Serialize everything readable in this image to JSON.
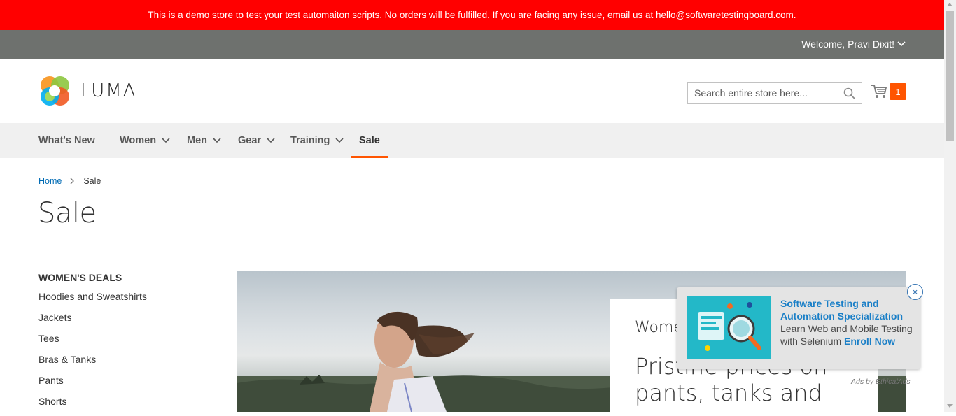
{
  "demo_notice": "This is a demo store to test your test automaiton scripts. No orders will be fulfilled. If you are facing any issue, email us at hello@softwaretestingboard.com.",
  "header_panel": {
    "welcome": "Welcome, Pravi Dixit!"
  },
  "logo": {
    "text": "LUMA"
  },
  "search": {
    "placeholder": "Search entire store here..."
  },
  "cart": {
    "count": "1"
  },
  "nav": [
    {
      "label": "What's New"
    },
    {
      "label": "Women"
    },
    {
      "label": "Men"
    },
    {
      "label": "Gear"
    },
    {
      "label": "Training"
    },
    {
      "label": "Sale"
    }
  ],
  "breadcrumb": {
    "home": "Home",
    "current": "Sale"
  },
  "page_title": "Sale",
  "sidebar": {
    "heading": "WOMEN'S DEALS",
    "items": [
      "Hoodies and Sweatshirts",
      "Jackets",
      "Tees",
      "Bras & Tanks",
      "Pants",
      "Shorts"
    ]
  },
  "hero": {
    "small": "Women",
    "big": "Pristine prices on pants, tanks and"
  },
  "ad": {
    "title": "Software Testing and Automation Specialization",
    "body": "Learn Web and Mobile Testing with Selenium",
    "cta": "Enroll Now",
    "attribution": "Ads by EthicalAds",
    "close": "×"
  },
  "colors": {
    "demo_bar": "#ff0000",
    "accent": "#ff5501",
    "link": "#006bb4"
  }
}
